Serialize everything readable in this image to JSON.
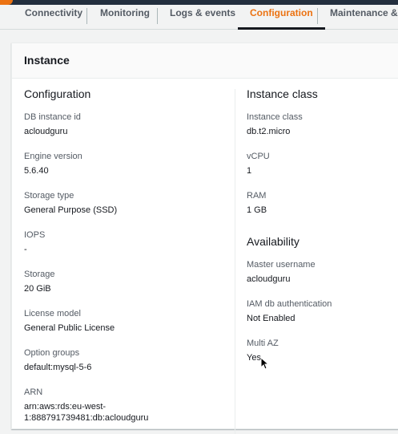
{
  "tabs": [
    {
      "label": "Connectivity"
    },
    {
      "label": "Monitoring"
    },
    {
      "label": "Logs & events"
    },
    {
      "label": "Configuration"
    },
    {
      "label": "Maintenance & ba"
    }
  ],
  "active_tab": "Configuration",
  "panel": {
    "title": "Instance"
  },
  "configuration": {
    "title": "Configuration",
    "fields": [
      {
        "label": "DB instance id",
        "value": "acloudguru"
      },
      {
        "label": "Engine version",
        "value": "5.6.40"
      },
      {
        "label": "Storage type",
        "value": "General Purpose (SSD)"
      },
      {
        "label": "IOPS",
        "value": "-"
      },
      {
        "label": "Storage",
        "value": "20 GiB"
      },
      {
        "label": "License model",
        "value": "General Public License"
      },
      {
        "label": "Option groups",
        "value": "default:mysql-5-6"
      },
      {
        "label": "ARN",
        "value": "arn:aws:rds:eu-west-",
        "value_line2": "1:888791739481:db:acloudguru"
      }
    ]
  },
  "instance_class": {
    "title": "Instance class",
    "fields": [
      {
        "label": "Instance class",
        "value": "db.t2.micro"
      },
      {
        "label": "vCPU",
        "value": "1"
      },
      {
        "label": "RAM",
        "value": "1 GB"
      }
    ]
  },
  "availability": {
    "title": "Availability",
    "fields": [
      {
        "label": "Master username",
        "value": "acloudguru"
      },
      {
        "label": "IAM db authentication",
        "value": "Not Enabled"
      },
      {
        "label": "Multi AZ",
        "value": "Yes"
      }
    ]
  },
  "colors": {
    "accent": "#ec7211",
    "header_bg": "#232f3e",
    "label": "#545b64",
    "text": "#16191f"
  }
}
